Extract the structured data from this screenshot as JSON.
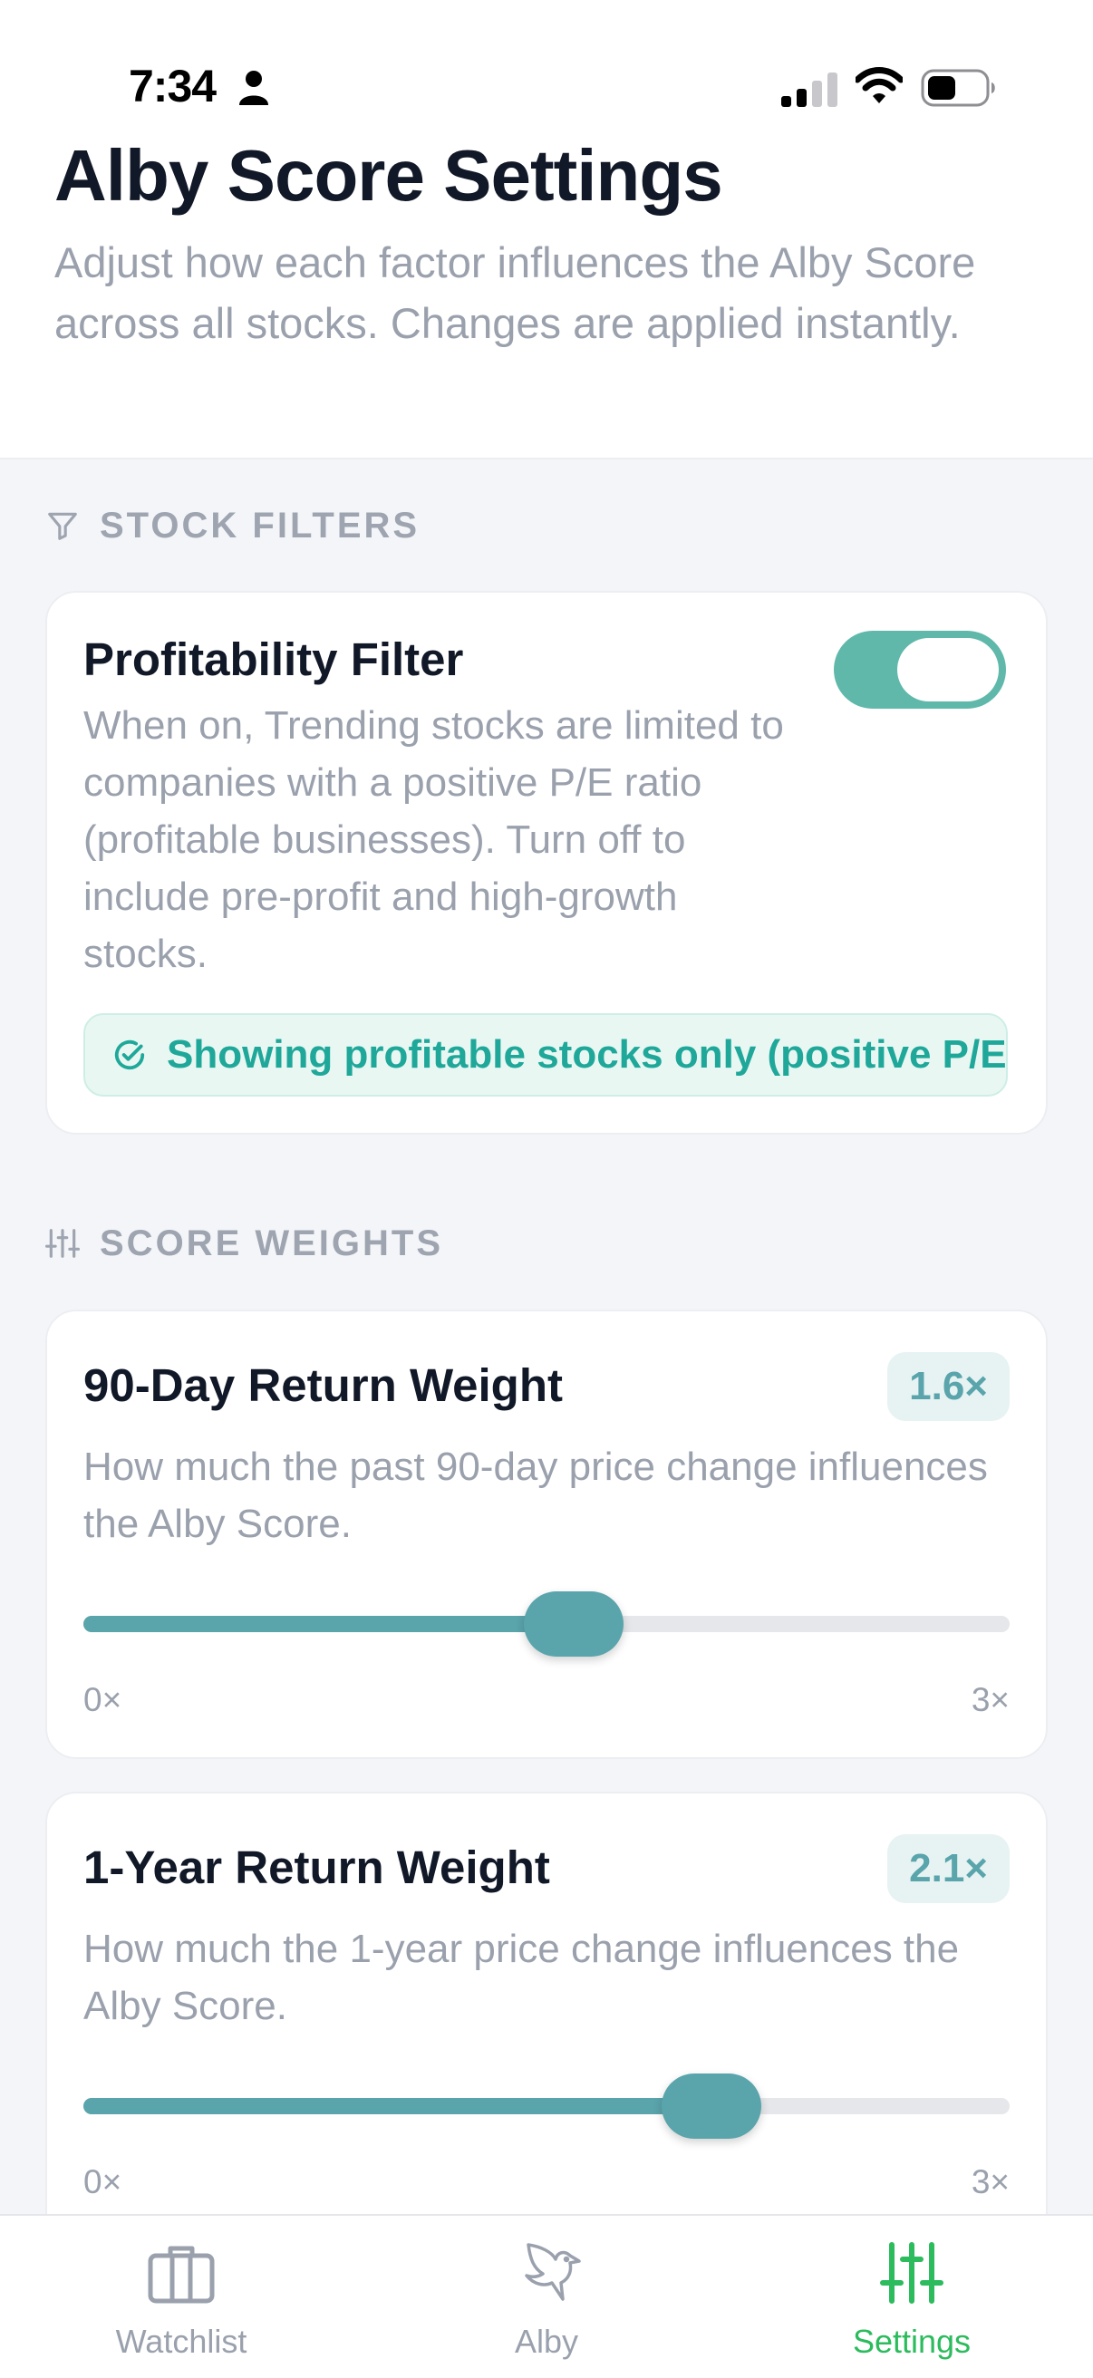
{
  "status_bar": {
    "time": "7:34"
  },
  "header": {
    "title": "Alby Score Settings",
    "description": "Adjust how each factor influences the Alby Score across all stocks. Changes are applied instantly."
  },
  "sections": {
    "filters_label": "STOCK FILTERS",
    "weights_label": "SCORE WEIGHTS"
  },
  "profitability_filter": {
    "title": "Profitability Filter",
    "description": "When on, Trending stocks are limited to companies with a positive P/E ratio (profitable businesses). Turn off to include pre-profit and high-growth stocks.",
    "enabled": true,
    "status": "Showing profitable stocks only (positive P/E)"
  },
  "weights": [
    {
      "title": "90-Day Return Weight",
      "value_label": "1.6×",
      "value": 1.6,
      "description": "How much the past 90-day price change influences the Alby Score.",
      "min_label": "0×",
      "max_label": "3×",
      "min": 0,
      "max": 3
    },
    {
      "title": "1-Year Return Weight",
      "value_label": "2.1×",
      "value": 2.1,
      "description": "How much the 1-year price change influences the Alby Score.",
      "min_label": "0×",
      "max_label": "3×",
      "min": 0,
      "max": 3
    }
  ],
  "tabbar": {
    "items": [
      {
        "label": "Watchlist",
        "icon": "briefcase-icon"
      },
      {
        "label": "Alby",
        "icon": "bird-icon"
      },
      {
        "label": "Settings",
        "icon": "sliders-icon"
      }
    ],
    "active": "Settings"
  },
  "colors": {
    "accent": "#5aa4ac",
    "toggle": "#5fb8aa",
    "status_text": "#1fa89a",
    "active_tab": "#2cbb5d"
  }
}
